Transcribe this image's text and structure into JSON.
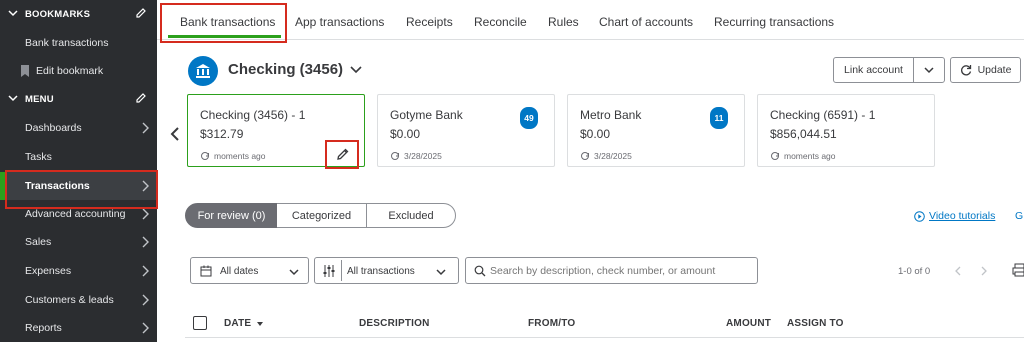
{
  "sidebar": {
    "bookmarks_header": "BOOKMARKS",
    "bookmarks": [
      {
        "label": "Bank transactions"
      },
      {
        "label": "Edit bookmark",
        "icon": "bookmark-icon"
      }
    ],
    "menu_header": "MENU",
    "menu_items": [
      {
        "label": "Dashboards"
      },
      {
        "label": "Tasks"
      },
      {
        "label": "Transactions",
        "active": true
      },
      {
        "label": "Advanced accounting"
      },
      {
        "label": "Sales"
      },
      {
        "label": "Expenses"
      },
      {
        "label": "Customers & leads"
      },
      {
        "label": "Reports"
      }
    ]
  },
  "tabs": [
    {
      "label": "Bank transactions",
      "active": true
    },
    {
      "label": "App transactions"
    },
    {
      "label": "Receipts"
    },
    {
      "label": "Reconcile"
    },
    {
      "label": "Rules"
    },
    {
      "label": "Chart of accounts"
    },
    {
      "label": "Recurring transactions"
    }
  ],
  "account": {
    "title": "Checking (3456)",
    "link_account": "Link account",
    "update": "Update"
  },
  "cards": [
    {
      "name": "Checking (3456) - 1",
      "amount": "$312.79",
      "updated": "moments ago",
      "selected": true
    },
    {
      "name": "Gotyme Bank",
      "amount": "$0.00",
      "updated": "3/28/2025",
      "badge": "49"
    },
    {
      "name": "Metro Bank",
      "amount": "$0.00",
      "updated": "3/28/2025",
      "badge": "11"
    },
    {
      "name": "Checking (6591) - 1",
      "amount": "$856,044.51",
      "updated": "moments ago"
    }
  ],
  "review_tabs": [
    {
      "label": "For review (0)",
      "selected": true
    },
    {
      "label": "Categorized"
    },
    {
      "label": "Excluded"
    }
  ],
  "video_tutorials": "Video tutorials",
  "cut_text": "G",
  "filters": {
    "dates": "All dates",
    "transactions": "All transactions",
    "search_placeholder": "Search by description, check number, or amount"
  },
  "pagination": "1-0 of 0",
  "table_headers": {
    "date": "DATE",
    "description": "DESCRIPTION",
    "from_to": "FROM/TO",
    "amount": "AMOUNT",
    "assign_to": "ASSIGN TO"
  },
  "colors": {
    "sidebar_bg": "#2b2d30",
    "accent_green": "#2ca01c",
    "brand_blue": "#0077c5",
    "highlight_red": "#d52b1e"
  }
}
